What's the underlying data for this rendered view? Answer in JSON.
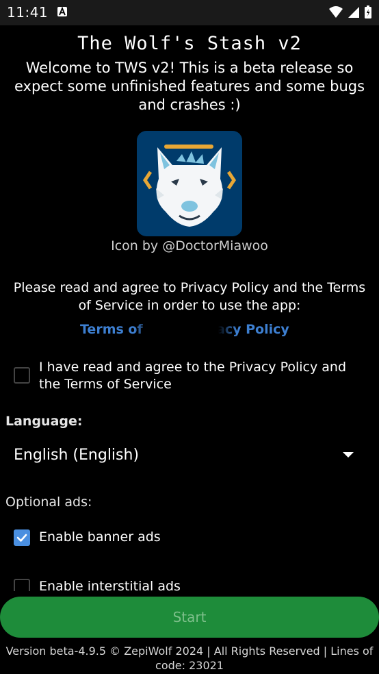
{
  "status_bar": {
    "time": "11:41"
  },
  "app": {
    "title": "The Wolf's Stash v2",
    "welcome": "Welcome to TWS v2! This is a beta release so expect some unfinished features and some bugs and crashes :)",
    "icon_credit": "Icon by @DoctorMiawoo"
  },
  "privacy": {
    "text": "Please read and agree to Privacy Policy and the Terms of Service in order to use the app:",
    "terms_link": "Terms of",
    "privacy_link": "acy Policy"
  },
  "agreement": {
    "label": "I have read and agree to the Privacy Policy and the Terms of Service",
    "checked": false
  },
  "language": {
    "label": "Language:",
    "selected": "English (English)"
  },
  "ads": {
    "label": "Optional ads:",
    "banner": {
      "label": "Enable banner ads",
      "checked": true
    },
    "interstitial": {
      "label": "Enable interstitial ads",
      "checked": false
    }
  },
  "start_button": {
    "label": "Start"
  },
  "footer": {
    "text": "Version beta-4.9.5 © ZepiWolf 2024 | All Rights Reserved | Lines of code: 23021"
  },
  "colors": {
    "accent": "#4a8fe0",
    "link": "#3d7fd1",
    "button": "#1e8c3a",
    "logo_bg": "#003b6b"
  }
}
